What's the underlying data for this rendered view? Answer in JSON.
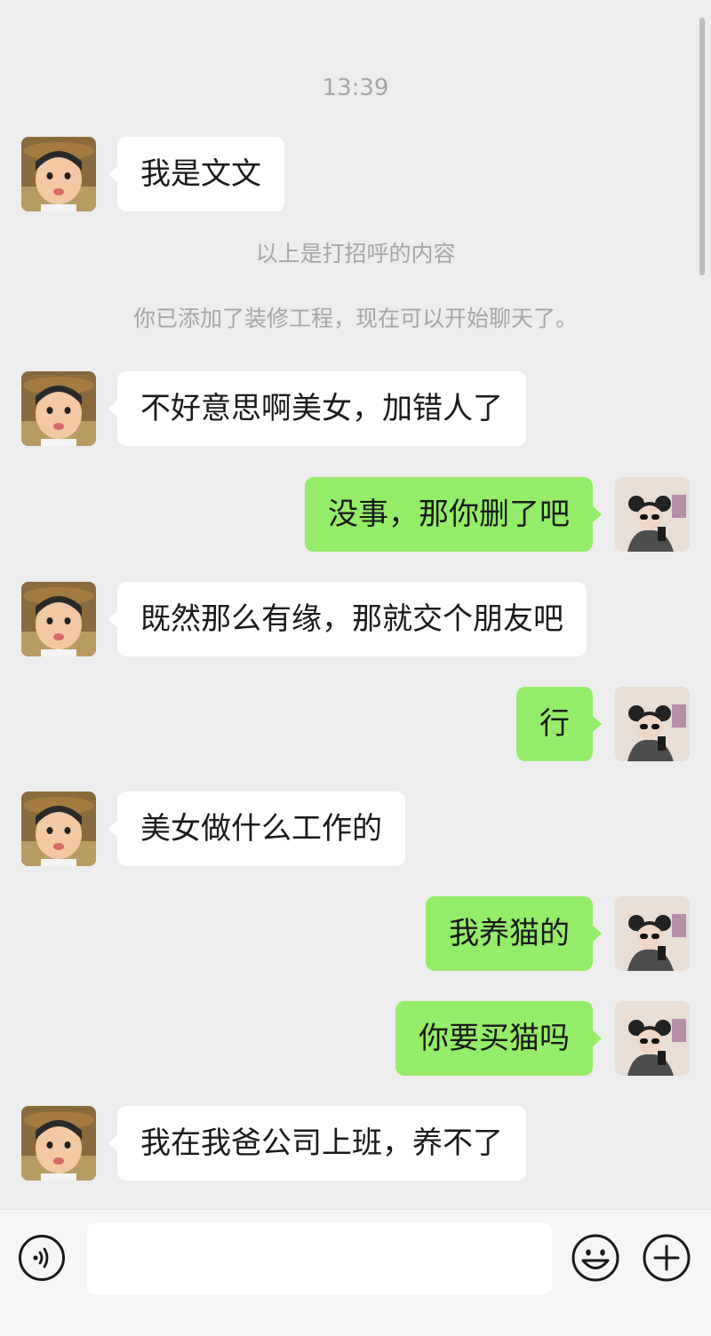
{
  "chat": {
    "timestamp": "13:39",
    "greeting_note": "以上是打招呼的内容",
    "added_note": "你已添加了装修工程，现在可以开始聊天了。",
    "messages": [
      {
        "side": "left",
        "text": "我是文文"
      },
      {
        "side": "left",
        "text": "不好意思啊美女，加错人了"
      },
      {
        "side": "right",
        "text": "没事，那你删了吧"
      },
      {
        "side": "left",
        "text": "既然那么有缘，那就交个朋友吧"
      },
      {
        "side": "right",
        "text": "行"
      },
      {
        "side": "left",
        "text": "美女做什么工作的"
      },
      {
        "side": "right",
        "text": "我养猫的"
      },
      {
        "side": "right",
        "text": "你要买猫吗"
      },
      {
        "side": "left",
        "text": "我在我爸公司上班，养不了"
      }
    ]
  },
  "input_bar": {
    "voice_icon": "voice-icon",
    "text_value": "",
    "emoji_icon": "emoji-icon",
    "plus_icon": "plus-icon"
  },
  "colors": {
    "background": "#ededed",
    "incoming_bubble": "#ffffff",
    "outgoing_bubble": "#95ec69",
    "meta_text": "#a6a6a6"
  }
}
